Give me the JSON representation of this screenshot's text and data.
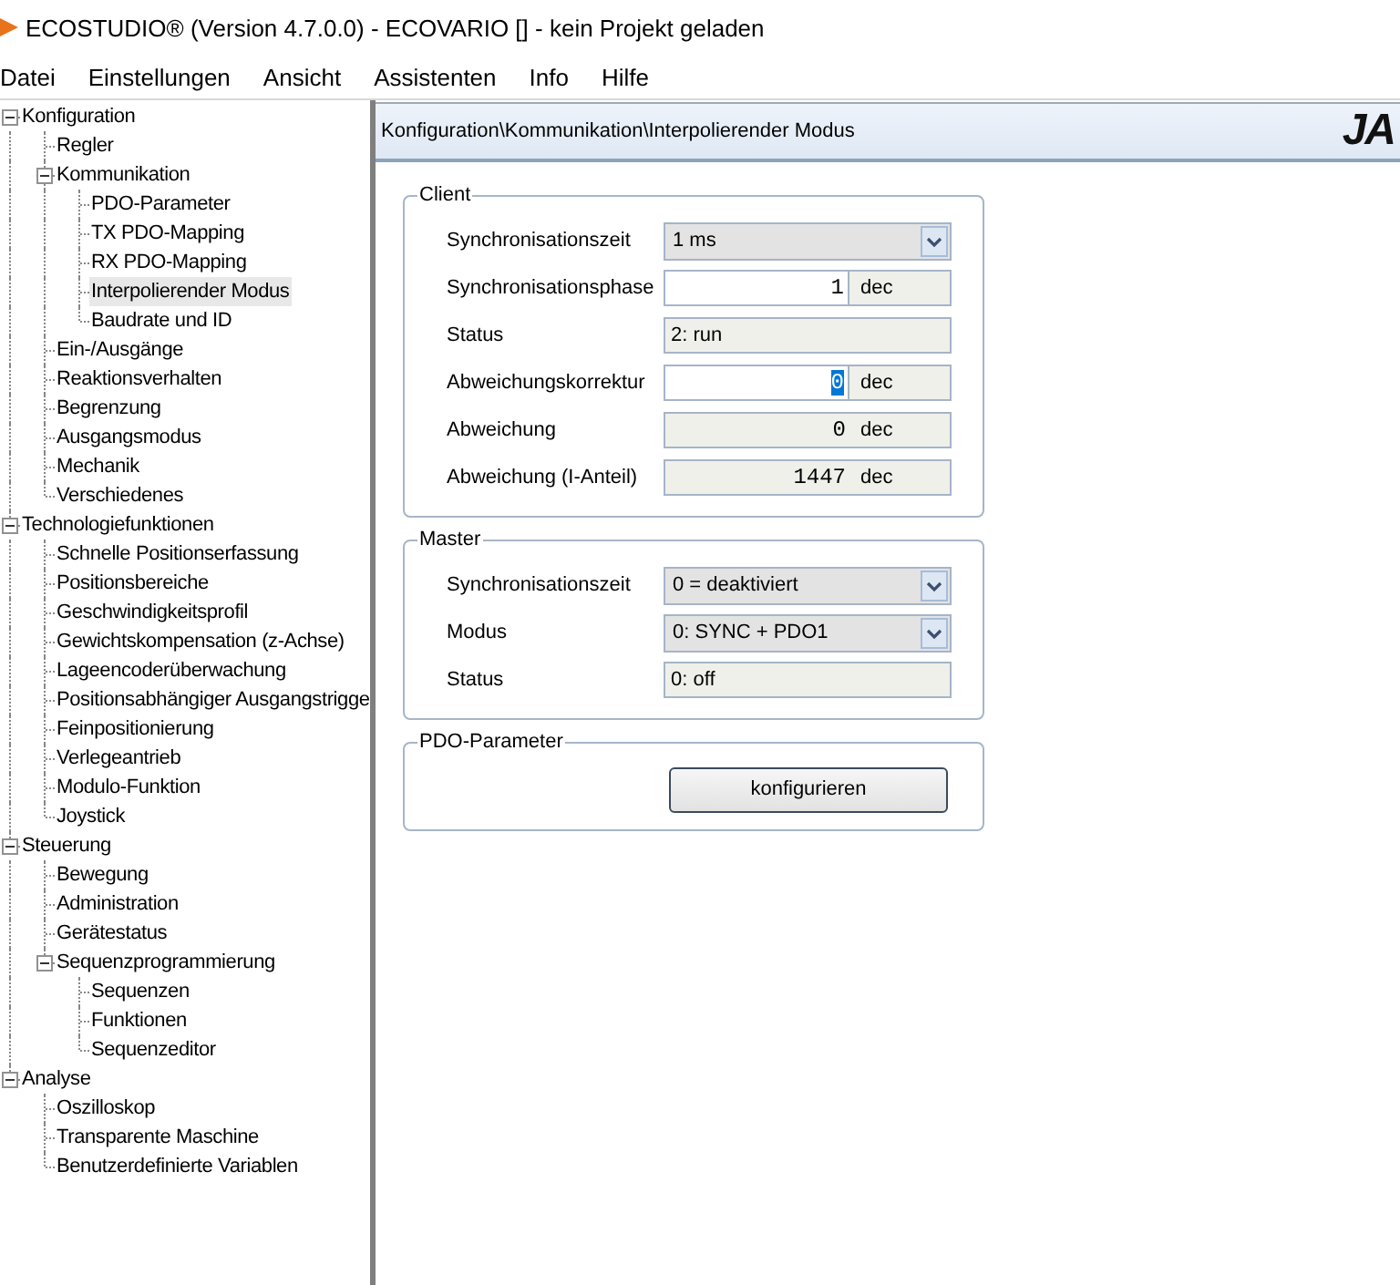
{
  "window": {
    "title": "ECOSTUDIO® (Version 4.7.0.0) - ECOVARIO [] - kein Projekt geladen"
  },
  "menu": [
    "Datei",
    "Einstellungen",
    "Ansicht",
    "Assistenten",
    "Info",
    "Hilfe"
  ],
  "tree": [
    {
      "label": "Konfiguration",
      "selected": false,
      "expanded": true,
      "children": [
        {
          "label": "Regler",
          "selected": false
        },
        {
          "label": "Kommunikation",
          "selected": false,
          "expanded": true,
          "children": [
            {
              "label": "PDO-Parameter",
              "selected": false
            },
            {
              "label": "TX PDO-Mapping",
              "selected": false
            },
            {
              "label": "RX PDO-Mapping",
              "selected": false
            },
            {
              "label": "Interpolierender Modus",
              "selected": true
            },
            {
              "label": "Baudrate und ID",
              "selected": false
            }
          ]
        },
        {
          "label": "Ein-/Ausgänge",
          "selected": false
        },
        {
          "label": "Reaktionsverhalten",
          "selected": false
        },
        {
          "label": "Begrenzung",
          "selected": false
        },
        {
          "label": "Ausgangsmodus",
          "selected": false
        },
        {
          "label": "Mechanik",
          "selected": false
        },
        {
          "label": "Verschiedenes",
          "selected": false
        }
      ]
    },
    {
      "label": "Technologiefunktionen",
      "selected": false,
      "expanded": true,
      "children": [
        {
          "label": "Schnelle Positionserfassung",
          "selected": false
        },
        {
          "label": "Positionsbereiche",
          "selected": false
        },
        {
          "label": "Geschwindigkeitsprofil",
          "selected": false
        },
        {
          "label": "Gewichtskompensation (z-Achse)",
          "selected": false
        },
        {
          "label": "Lageencoderüberwachung",
          "selected": false
        },
        {
          "label": "Positionsabhängiger Ausgangstrigge",
          "selected": false
        },
        {
          "label": "Feinpositionierung",
          "selected": false
        },
        {
          "label": "Verlegeantrieb",
          "selected": false
        },
        {
          "label": "Modulo-Funktion",
          "selected": false
        },
        {
          "label": "Joystick",
          "selected": false
        }
      ]
    },
    {
      "label": "Steuerung",
      "selected": false,
      "expanded": true,
      "children": [
        {
          "label": "Bewegung",
          "selected": false
        },
        {
          "label": "Administration",
          "selected": false
        },
        {
          "label": "Gerätestatus",
          "selected": false
        },
        {
          "label": "Sequenzprogrammierung",
          "selected": false,
          "expanded": true,
          "children": [
            {
              "label": "Sequenzen",
              "selected": false
            },
            {
              "label": "Funktionen",
              "selected": false
            },
            {
              "label": "Sequenzeditor",
              "selected": false
            }
          ]
        }
      ]
    },
    {
      "label": "Analyse",
      "selected": false,
      "expanded": true,
      "children": [
        {
          "label": "Oszilloskop",
          "selected": false
        },
        {
          "label": "Transparente Maschine",
          "selected": false
        },
        {
          "label": "Benutzerdefinierte Variablen",
          "selected": false
        }
      ]
    }
  ],
  "header": {
    "path": "Konfiguration\\Kommunikation\\Interpolierender Modus",
    "logo": "JA"
  },
  "groups": [
    {
      "title": "Client",
      "rows": [
        {
          "kind": "select",
          "label": "Synchronisationszeit",
          "value": "1 ms"
        },
        {
          "kind": "number",
          "label": "Synchronisationsphase",
          "value": "1",
          "unit": "dec",
          "editable": true,
          "text_selected": false
        },
        {
          "kind": "text",
          "label": "Status",
          "value": "2: run"
        },
        {
          "kind": "number",
          "label": "Abweichungskorrektur",
          "value": "0",
          "unit": "dec",
          "editable": true,
          "text_selected": true
        },
        {
          "kind": "number",
          "label": "Abweichung",
          "value": "0",
          "unit": "dec",
          "editable": false,
          "text_selected": false
        },
        {
          "kind": "number",
          "label": "Abweichung (I-Anteil)",
          "value": "1447",
          "unit": "dec",
          "editable": false,
          "text_selected": false
        }
      ]
    },
    {
      "title": "Master",
      "rows": [
        {
          "kind": "select",
          "label": "Synchronisationszeit",
          "value": "0 = deaktiviert"
        },
        {
          "kind": "select",
          "label": "Modus",
          "value": "0: SYNC + PDO1"
        },
        {
          "kind": "text",
          "label": "Status",
          "value": "0: off"
        }
      ]
    },
    {
      "title": "PDO-Parameter",
      "rows": [
        {
          "kind": "button",
          "label": "konfigurieren"
        }
      ]
    }
  ]
}
